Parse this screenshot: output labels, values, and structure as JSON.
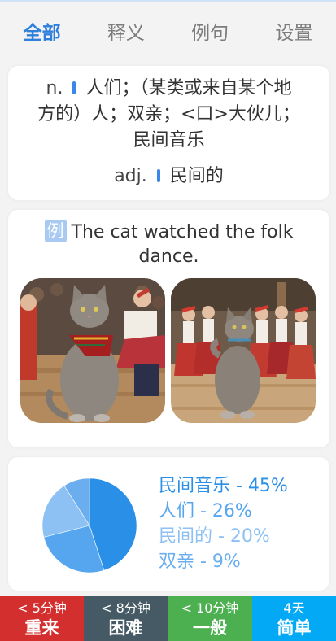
{
  "tabs": [
    {
      "label": "全部",
      "active": true
    },
    {
      "label": "释义",
      "active": false
    },
    {
      "label": "例句",
      "active": false
    },
    {
      "label": "设置",
      "active": false
    }
  ],
  "definitions": [
    {
      "pos": "n.",
      "meaning_lines": [
        "人们；（某类或来自某个地",
        "方的）人；双亲；<口>大伙儿；",
        "民间音乐"
      ]
    },
    {
      "pos": "adj.",
      "meaning": "民间的"
    }
  ],
  "example": {
    "badge": "例",
    "sentence": "The cat watched the folk dance."
  },
  "chart_data": {
    "type": "pie",
    "slices": [
      {
        "label": "民间音乐 - 45%",
        "value": 45,
        "color": "#2a8fe6"
      },
      {
        "label": "人们 - 26%",
        "value": 26,
        "color": "#56a6ef"
      },
      {
        "label": "民间的 - 20%",
        "value": 20,
        "color": "#8ec1f3"
      },
      {
        "label": "双亲 - 9%",
        "value": 9,
        "color": "#6aaef0"
      }
    ]
  },
  "buttons": [
    {
      "time": "< 5分钟",
      "label": "重来",
      "color": "#d32f2f"
    },
    {
      "time": "< 8分钟",
      "label": "困难",
      "color": "#455a64"
    },
    {
      "time": "< 10分钟",
      "label": "一般",
      "color": "#4caf50"
    },
    {
      "time": "4天",
      "label": "简单",
      "color": "#03a9f4"
    }
  ]
}
